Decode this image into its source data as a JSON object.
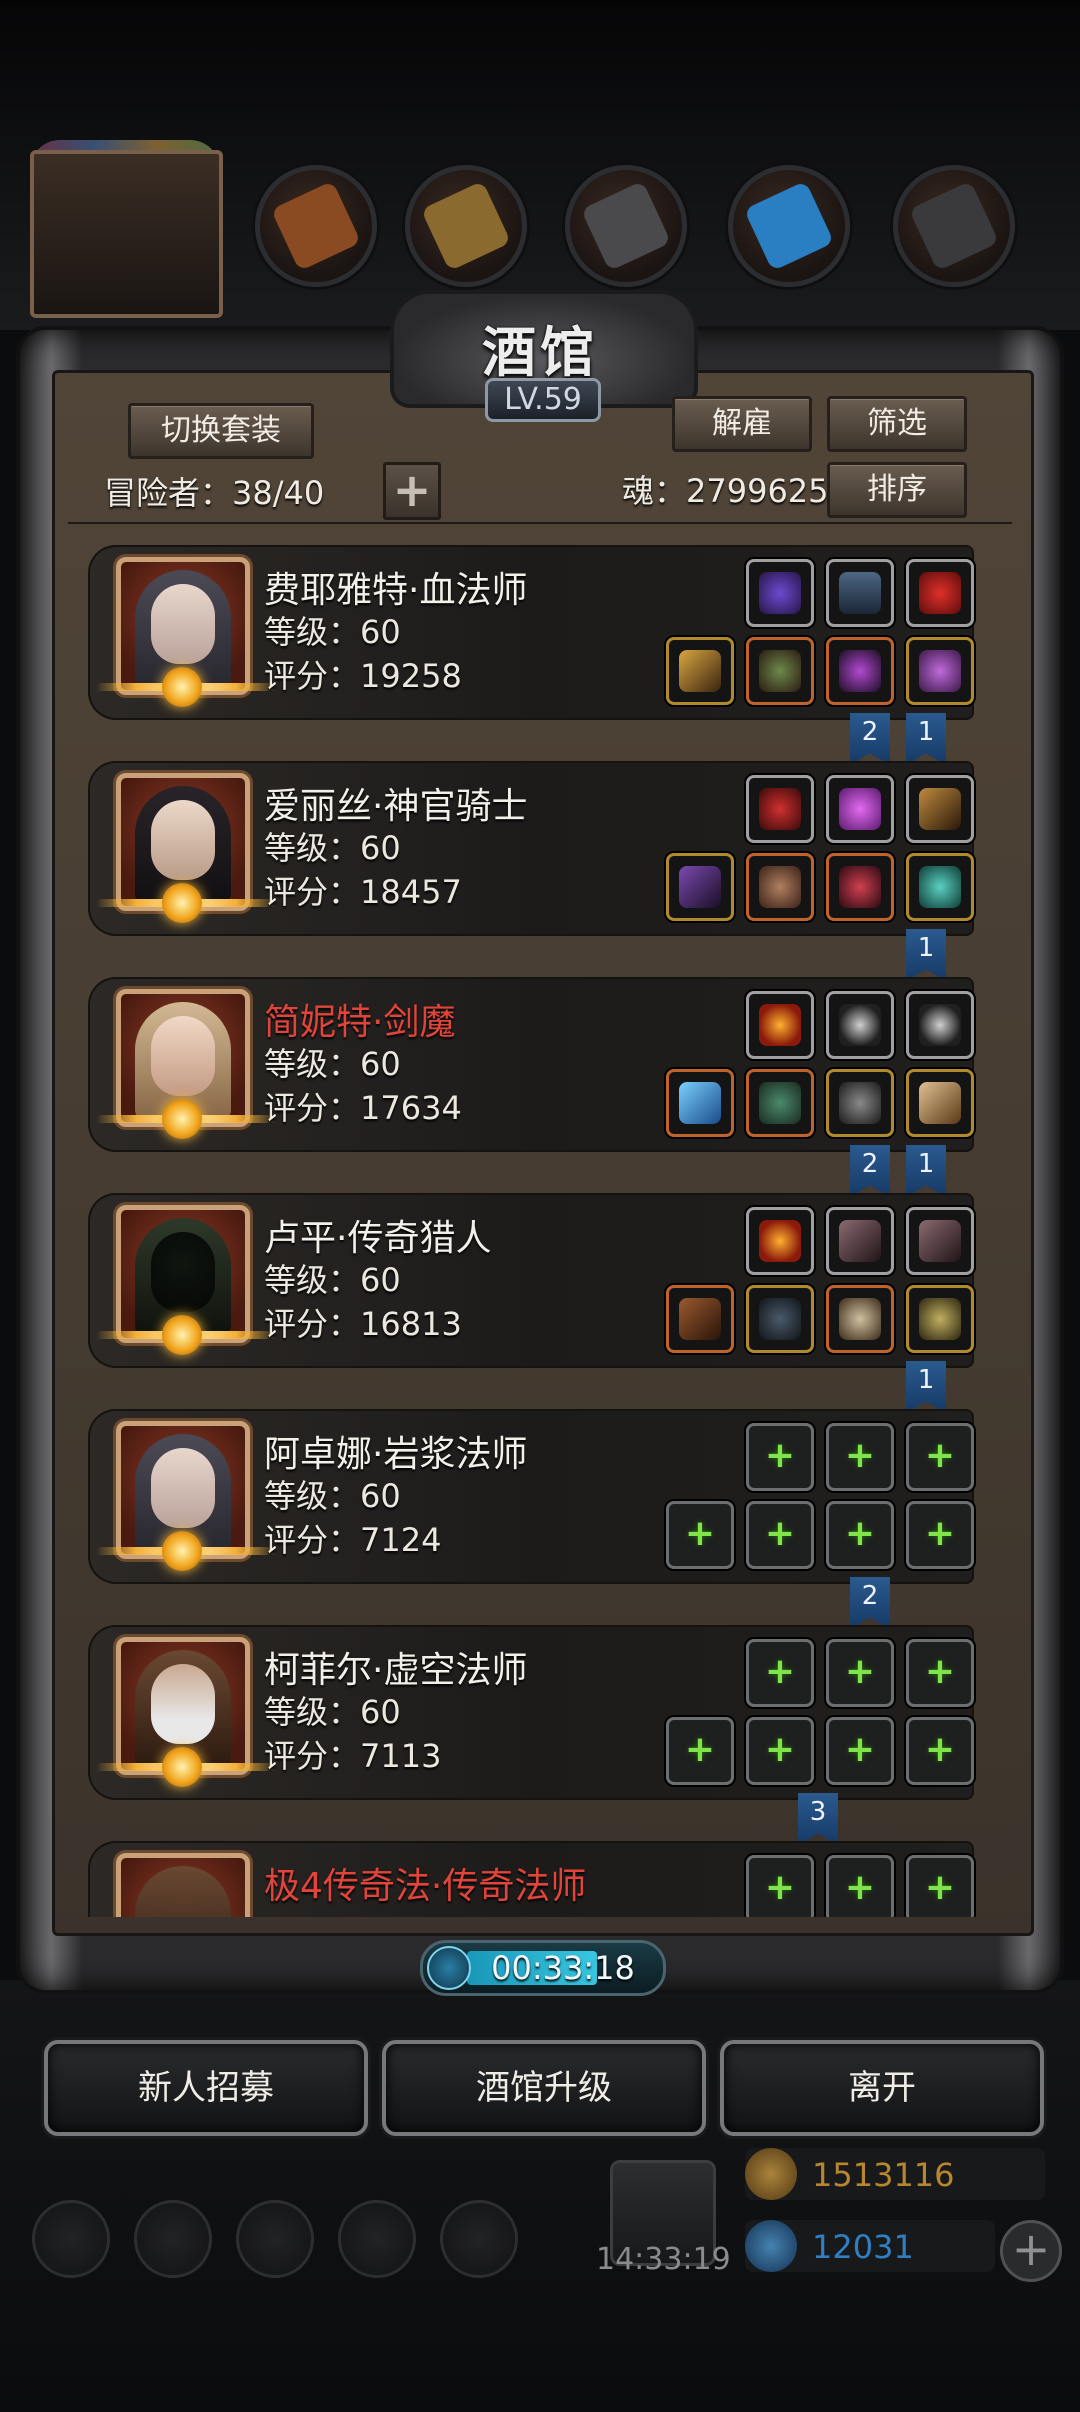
{
  "title": "酒馆",
  "level": "LV.59",
  "buttons": {
    "switch_outfit": "切换套装",
    "dismiss": "解雇",
    "filter": "筛选",
    "sort": "排序",
    "add": "+"
  },
  "header": {
    "adventurers": "冒险者：38/40",
    "soul": "魂：2799625"
  },
  "heroes": [
    {
      "name": "费耶雅特·血法师",
      "level": "等级：60",
      "score": "评分：19258",
      "name_color": "white"
    },
    {
      "name": "爱丽丝·神官骑士",
      "level": "等级：60",
      "score": "评分：18457",
      "name_color": "white"
    },
    {
      "name": "简妮特·剑魔",
      "level": "等级：60",
      "score": "评分：17634",
      "name_color": "red"
    },
    {
      "name": "卢平·传奇猎人",
      "level": "等级：60",
      "score": "评分：16813",
      "name_color": "white"
    },
    {
      "name": "阿卓娜·岩浆法师",
      "level": "等级：60",
      "score": "评分：7124",
      "name_color": "white"
    },
    {
      "name": "柯菲尔·虚空法师",
      "level": "等级：60",
      "score": "评分：7113",
      "name_color": "white"
    },
    {
      "name": "极4传奇法·传奇法师",
      "level": "",
      "score": "",
      "name_color": "red"
    }
  ],
  "flags": {
    "f1a": "2",
    "f1b": "1",
    "f2a": "1",
    "f3a": "2",
    "f3b": "1",
    "f4a": "1",
    "f5a": "2",
    "f6a": "3"
  },
  "timer": "00:33:18",
  "bottom_buttons": {
    "recruit": "新人招募",
    "upgrade": "酒馆升级",
    "leave": "离开"
  },
  "resources": {
    "gold": "1513116",
    "gems": "12031",
    "gift_time": "14:33:19"
  },
  "colors": {
    "accent_red": "#e0443a",
    "gold_text": "#b8862e",
    "gem_text": "#2f7fc2",
    "empty_slot_plus": "#7fe34a"
  }
}
